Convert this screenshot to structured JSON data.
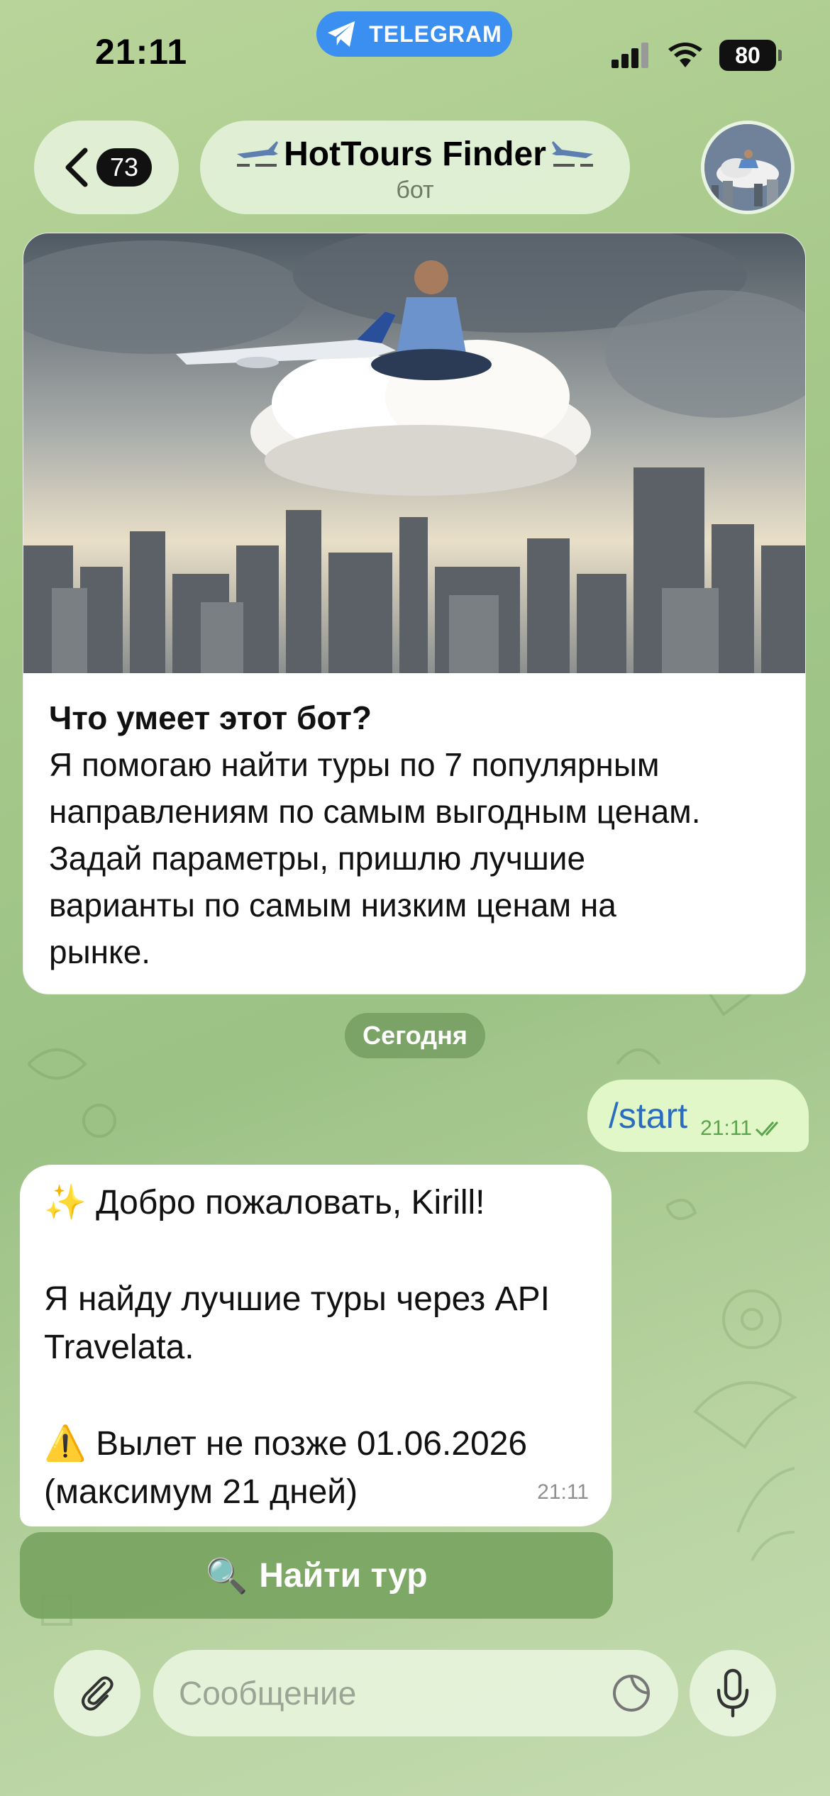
{
  "status_bar": {
    "time": "21:11",
    "battery": "80",
    "app_pill": "TELEGRAM"
  },
  "header": {
    "unread_count": "73",
    "title": "HotTours Finder",
    "subtitle": "бот"
  },
  "bot_intro": {
    "title": "Что умеет этот бот?",
    "lines": [
      "Я помогаю найти туры по 7 популярным",
      "направлениям по самым выгодным ценам.",
      "Задай параметры, пришлю лучшие",
      "варианты по самым низким ценам на",
      "рынке."
    ]
  },
  "date_divider": "Сегодня",
  "outgoing_message": {
    "text": "/start",
    "time": "21:11"
  },
  "incoming_message": {
    "lines": [
      "✨ Добро пожаловать, Kirill!",
      "",
      "Я найду лучшие туры через API",
      "Travelata.",
      "",
      "⚠️ Вылет не позже 01.06.2026",
      "(максимум 21 дней)"
    ],
    "time": "21:11"
  },
  "inline_button": {
    "icon": "🔍",
    "label": "Найти тур"
  },
  "composer": {
    "placeholder": "Сообщение"
  },
  "icons": [
    "telegram-plane-icon",
    "signal-icon",
    "wifi-icon",
    "chevron-left-icon",
    "airplane-icon",
    "attach-icon",
    "sticker-icon",
    "microphone-icon",
    "double-check-icon"
  ]
}
